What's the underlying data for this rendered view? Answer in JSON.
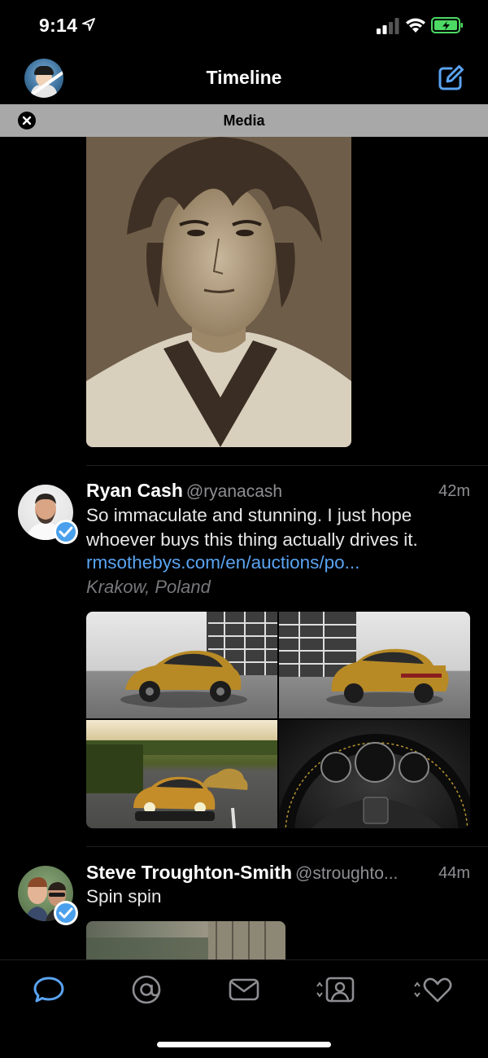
{
  "status": {
    "time": "9:14"
  },
  "nav": {
    "title": "Timeline"
  },
  "filter": {
    "label": "Media"
  },
  "tweets": [
    {
      "name": "Ryan Cash",
      "handle": "@ryanacash",
      "time": "42m",
      "text": "So immaculate and stunning. I just hope whoever buys this thing actually drives it.",
      "link": "rmsothebys.com/en/auctions/po...",
      "location": "Krakow, Poland"
    },
    {
      "name": "Steve Troughton-Smith",
      "handle": "@stroughto...",
      "time": "44m",
      "text": "Spin spin"
    }
  ],
  "tabs": [
    "timeline",
    "mentions",
    "messages",
    "profile",
    "likes"
  ],
  "colors": {
    "accent": "#5aa4f2",
    "background": "#000000",
    "filterBar": "#a8a8a8"
  }
}
